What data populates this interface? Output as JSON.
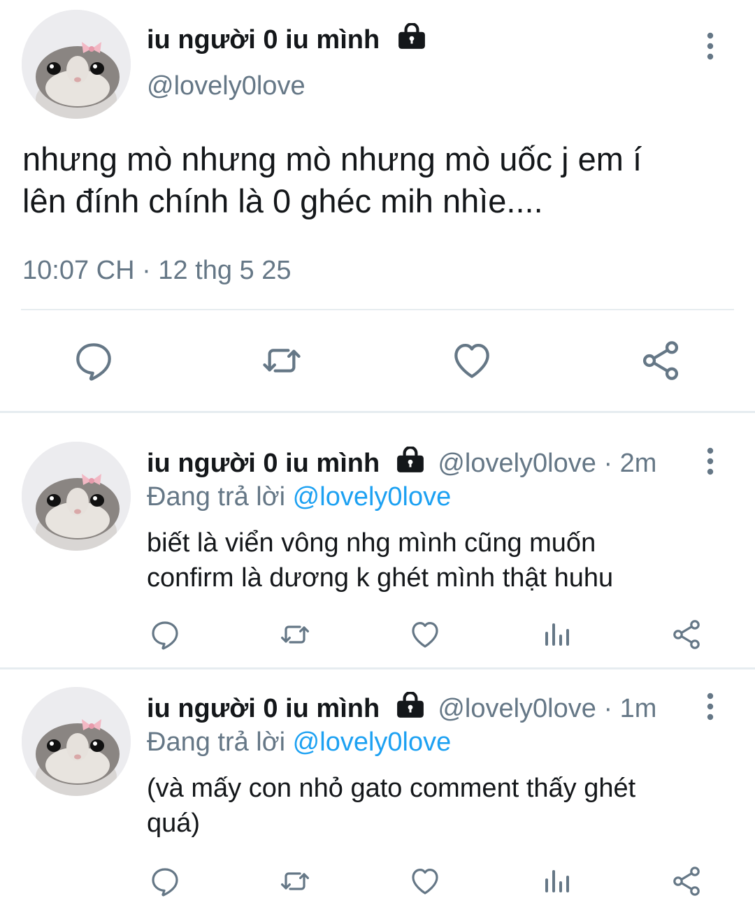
{
  "main_tweet": {
    "display_name": "iu người 0 iu mình",
    "handle": "@lovely0love",
    "text_line1": "nhưng mò nhưng mò nhưng mò uốc j em í",
    "text_line2": "lên đính chính là 0 ghéc mih nhìe....",
    "timestamp": "10:07 CH · 12 thg 5 25"
  },
  "replies": [
    {
      "display_name": "iu người 0 iu mình",
      "handle_time": "@lovely0love · 2m",
      "replying_prefix": "Đang trả lời",
      "replying_to": "@lovely0love",
      "text_line1": "biết là viển vông nhg mình cũng muốn",
      "text_line2": "confirm là dương k ghét mình thật huhu"
    },
    {
      "display_name": "iu người 0 iu mình",
      "handle_time": "@lovely0love · 1m",
      "replying_prefix": "Đang trả lời",
      "replying_to": "@lovely0love",
      "text_line1": "(và mấy con nhỏ gato comment thấy ghét",
      "text_line2": "quá)"
    }
  ],
  "icons": {
    "reply": "speech-bubble-icon",
    "retweet": "retweet-icon",
    "like": "heart-icon",
    "views": "bar-chart-icon",
    "share": "share-icon",
    "more": "vertical-dots-icon",
    "lock": "lock-icon"
  },
  "colors": {
    "text": "#14171a",
    "secondary": "#657786",
    "link": "#1da1f2",
    "divider": "#e6ecf0"
  }
}
